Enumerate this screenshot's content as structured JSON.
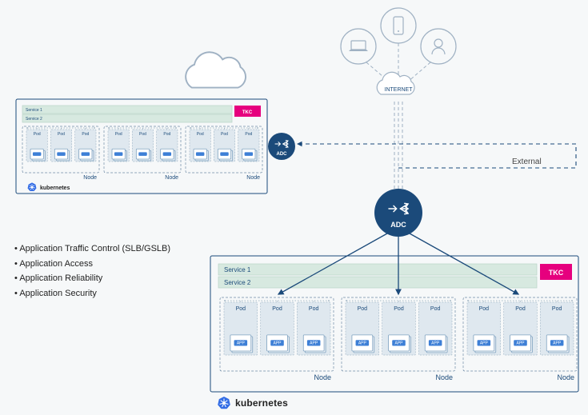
{
  "clients": {
    "internet_label": "INTERNET"
  },
  "adc": {
    "big_label": "ADC",
    "small_label": "ADC"
  },
  "external_label": "External",
  "tkc_label": "TKC",
  "service_labels": [
    "Service 1",
    "Service 2"
  ],
  "node_label": "Node",
  "pod_label": "Pod",
  "app_badge": "APP",
  "k8s_label": "kubernetes",
  "bullets": [
    "Application Traffic Control (SLB/GSLB)",
    "Application Access",
    "Application Reliability",
    "Application Security"
  ],
  "diagram_structure": {
    "description": "Kubernetes ADC architecture: clients (laptop, phone, user) reach Internet cloud, flowing to a large ADC which load-balances into the main Kubernetes cluster (3 nodes × 3 pods, Service1/Service2 bars, TKC controller). A secondary smaller cluster (same 3×3 layout) on the left is reached via a small ADC over an External dashed link from the main ADC.",
    "clusters": 2,
    "nodes_per_cluster": 3,
    "pods_per_node": 3
  }
}
